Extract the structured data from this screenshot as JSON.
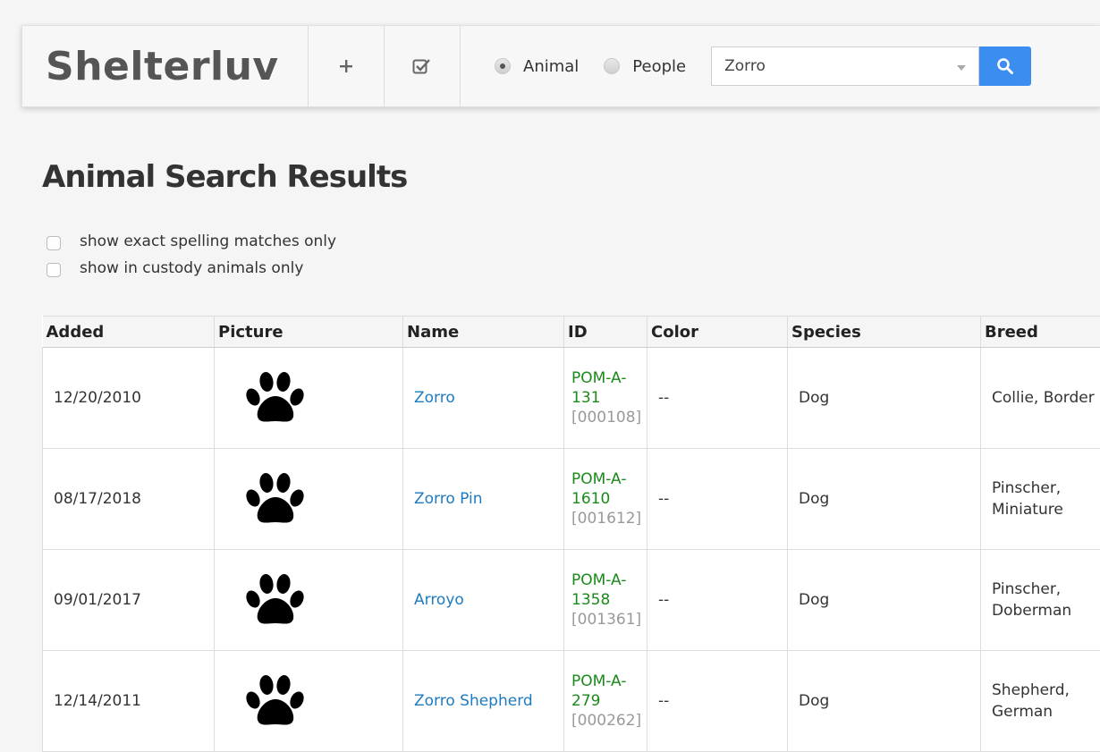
{
  "app": {
    "brand": "Shelterluv"
  },
  "nav": {
    "add_icon": "plus-icon",
    "check_icon": "checkbox-icon"
  },
  "search": {
    "options": [
      {
        "label": "Animal",
        "selected": true
      },
      {
        "label": "People",
        "selected": false
      }
    ],
    "value": "Zorro",
    "button_icon": "search-icon",
    "accent": "#3b8ef0"
  },
  "page": {
    "title": "Animal Search Results"
  },
  "filters": [
    {
      "label": "show exact spelling matches only",
      "checked": false
    },
    {
      "label": "show in custody animals only",
      "checked": false
    }
  ],
  "table": {
    "columns": [
      "Added",
      "Picture",
      "Name",
      "ID",
      "Color",
      "Species",
      "Breed"
    ],
    "rows": [
      {
        "added": "12/20/2010",
        "picture": "paw-icon",
        "name": "Zorro",
        "id_top": "POM-A-",
        "id_num": "131",
        "id_sub": "[000108]",
        "color": "--",
        "species": "Dog",
        "breed1": "Collie, Border",
        "breed2": ""
      },
      {
        "added": "08/17/2018",
        "picture": "paw-icon",
        "name": "Zorro Pin",
        "id_top": "POM-A-",
        "id_num": "1610",
        "id_sub": "[001612]",
        "color": "--",
        "species": "Dog",
        "breed1": "Pinscher,",
        "breed2": "Miniature"
      },
      {
        "added": "09/01/2017",
        "picture": "paw-icon",
        "name": "Arroyo",
        "id_top": "POM-A-",
        "id_num": "1358",
        "id_sub": "[001361]",
        "color": "--",
        "species": "Dog",
        "breed1": "Pinscher,",
        "breed2": "Doberman"
      },
      {
        "added": "12/14/2011",
        "picture": "paw-icon",
        "name": "Zorro Shepherd",
        "id_top": "POM-A-",
        "id_num": "279",
        "id_sub": "[000262]",
        "color": "--",
        "species": "Dog",
        "breed1": "Shepherd,",
        "breed2": "German"
      }
    ]
  }
}
